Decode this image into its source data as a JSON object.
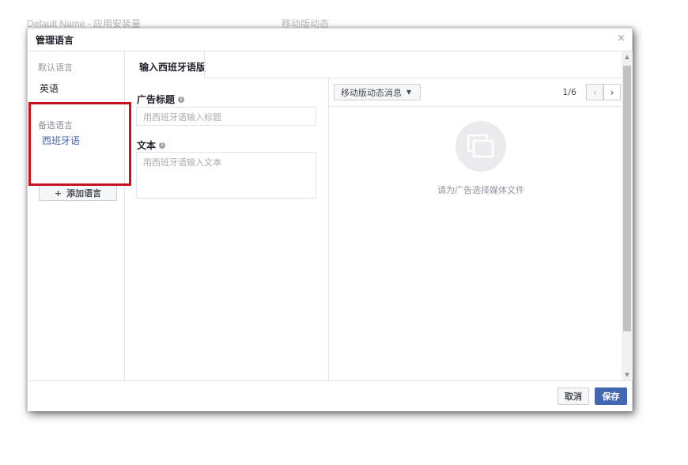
{
  "background": {
    "text_left": "Default Name - 应用安装量",
    "text_right": "移动版动态"
  },
  "dialog": {
    "title": "管理语言",
    "close_glyph": "×",
    "languages": {
      "default_label": "默认语言",
      "default_language": "英语",
      "alternate_label": "备选语言",
      "alternate_language": "西班牙语",
      "add_button_icon": "+",
      "add_button": "添加语言"
    },
    "tab": {
      "active_label": "输入西班牙语版"
    },
    "form": {
      "headline_label": "广告标题",
      "headline_placeholder": "用西班牙语输入标题",
      "text_label": "文本",
      "text_placeholder": "用西班牙语输入文本",
      "info_glyph": "i"
    },
    "preview": {
      "format_dropdown": "移动版动态消息",
      "dropdown_caret": "▼",
      "page_indicator": "1/6",
      "prev_glyph": "‹",
      "next_glyph": "›",
      "media_prompt": "请为广告选择媒体文件",
      "media_icon": "gallery-icon"
    },
    "scrollbar": {
      "up_glyph": "▲",
      "down_glyph": "▼"
    },
    "footer": {
      "cancel": "取消",
      "save": "保存"
    }
  },
  "colors": {
    "accent": "#4267b2",
    "link": "#4267b2",
    "highlight_box": "#c8101e",
    "muted_text": "#90949c"
  }
}
